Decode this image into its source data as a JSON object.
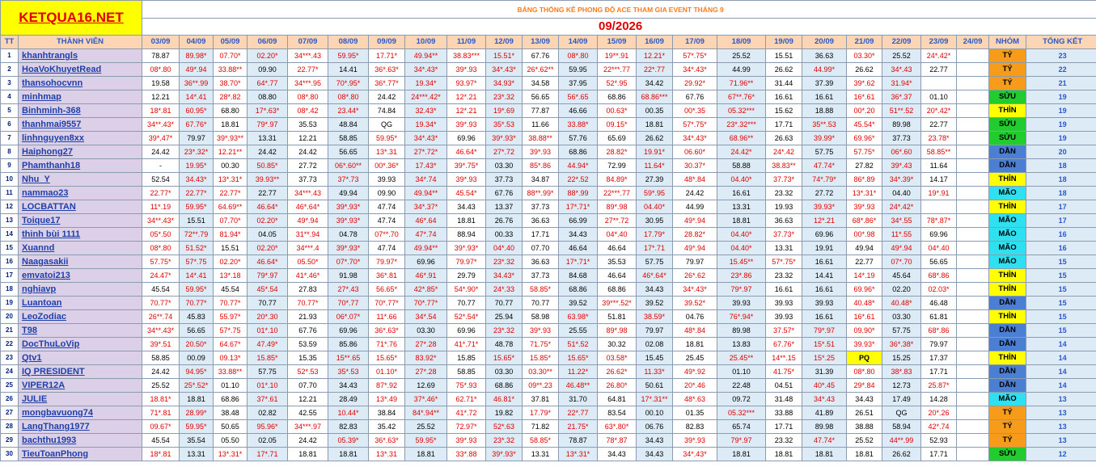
{
  "site_name": "KETQUA16.NET",
  "banner": "BẢNG THỐNG KÊ PHONG ĐỘ ACE THAM GIA EVENT THÁNG 9",
  "month_label": "09/2026",
  "headers": {
    "tt": "TT",
    "member": "THÀNH VIÊN",
    "dates": [
      "03/09",
      "04/09",
      "05/09",
      "06/09",
      "07/09",
      "08/09",
      "09/09",
      "10/09",
      "11/09",
      "12/09",
      "13/09",
      "14/09",
      "15/09",
      "16/09",
      "17/09",
      "18/09",
      "19/09",
      "20/09",
      "21/09",
      "22/09",
      "23/09",
      "24/09"
    ],
    "group": "NHÓM",
    "total": "TỔNG KẾT"
  },
  "group_colors": {
    "TÝ": "#f79b1a",
    "SỬU": "#22cc2f",
    "THÌN": "#ffff00",
    "DẦN": "#4a7fd4",
    "MÃO": "#2fe0f0"
  },
  "rows": [
    {
      "tt": "1",
      "name": "khanhtrangls",
      "vals": [
        "78.87",
        "89.98*",
        "07.70*",
        "02.20*",
        "34***.43",
        "59.95*",
        "17.71*",
        "49.94**",
        "38.83***",
        "15.51*",
        "67.76",
        "08*.80",
        "19**.91",
        "12.21*",
        "57*.75*",
        "25.52",
        "15.51",
        "36.63",
        "03.30*",
        "25.52",
        "24*.42*",
        ""
      ],
      "group": "TÝ",
      "total": "23"
    },
    {
      "tt": "2",
      "name": "HoaVoKhuyetRead",
      "vals": [
        "08*.80",
        "49*.94",
        "33.88**",
        "09.90",
        "22.77*",
        "14.41",
        "36*.63*",
        "34*.43*",
        "39*.93",
        "34*.43*",
        "26*.62**",
        "59.95",
        "22***.77",
        "22*.77",
        "34*.43*",
        "44.99",
        "26.62",
        "44.99*",
        "26.62",
        "34*.43",
        "22.77",
        ""
      ],
      "group": "TÝ",
      "total": "22"
    },
    {
      "tt": "3",
      "name": "thansohocvnn",
      "vals": [
        "19.58",
        "36**.99",
        "38.70*",
        "64*.77",
        "34***.95",
        "70*.95*",
        "36*.77*",
        "19.34*",
        "93.97*",
        "34.93*",
        "34.58",
        "37.95",
        "52*.95",
        "34.42",
        "29.92*",
        "71.96**",
        "31.44",
        "37.39",
        "39*.62",
        "31.94*",
        "",
        ""
      ],
      "group": "TÝ",
      "total": "21"
    },
    {
      "tt": "4",
      "name": "minhmap",
      "vals": [
        "12.21",
        "14*.41",
        "28*.82",
        "08.80",
        "08*.80",
        "08*.80",
        "24.42",
        "24***.42*",
        "12*.21",
        "23*.32",
        "56.65",
        "56*.65",
        "68.86",
        "68.86***",
        "67.76",
        "67**.76*",
        "16.61",
        "16.61",
        "16*.61",
        "36*.37",
        "01.10",
        ""
      ],
      "group": "SỬU",
      "total": "19"
    },
    {
      "tt": "5",
      "name": "Binhminh-368",
      "vals": [
        "18*.81",
        "60.95*",
        "68.80",
        "17*.63*",
        "08*.42",
        "23.44*",
        "74.84",
        "32.43*",
        "12*.21",
        "19*.69",
        "77.87",
        "46.66",
        "00.63*",
        "00.35",
        "00*.35",
        "05.32***",
        "15.62",
        "18.88",
        "00*.20",
        "51**.52",
        "20*.42*",
        ""
      ],
      "group": "THÌN",
      "total": "19"
    },
    {
      "tt": "6",
      "name": "thanhmai9557",
      "vals": [
        "34**.43*",
        "67.76*",
        "18.81",
        "79*.97",
        "35.53",
        "48.84",
        "QG",
        "19.34*",
        "39*.93",
        "35*.53",
        "11.66",
        "33.88*",
        "09.15*",
        "18.81",
        "57*.75*",
        "23*.32***",
        "17.71",
        "35**.53",
        "45.54*",
        "89.98",
        "22.77",
        ""
      ],
      "group": "SỬU",
      "total": "19"
    },
    {
      "tt": "7",
      "name": "linhnguyen8xx",
      "vals": [
        "39*.47*",
        "79.97",
        "39*.93**",
        "13.31",
        "12.21",
        "58.85",
        "59.95*",
        "34*.43*",
        "69.96",
        "39*.93*",
        "38.88**",
        "57.76",
        "65.69",
        "26.62",
        "34*.43*",
        "68.96**",
        "26.63",
        "39.99*",
        "69.96*",
        "37.73",
        "23.78*",
        ""
      ],
      "group": "SỬU",
      "total": "19"
    },
    {
      "tt": "8",
      "name": "Haiphong27",
      "vals": [
        "24.42",
        "23*.32*",
        "12.21**",
        "24.42",
        "24.42",
        "56.65",
        "13*.31",
        "27*.72*",
        "46.64*",
        "27*.72",
        "39*.93",
        "68.86",
        "28.82*",
        "19.91*",
        "06.60*",
        "24.42*",
        "24*.42",
        "57.75",
        "57.75*",
        "06*.60",
        "58.85**",
        ""
      ],
      "group": "DẦN",
      "total": "20"
    },
    {
      "tt": "9",
      "name": "Phamthanh18",
      "vals": [
        "-",
        "19.95*",
        "00.30",
        "50.85*",
        "27.72",
        "06*.60**",
        "00*.36*",
        "17.43*",
        "39*.75*",
        "03.30",
        "85*.86",
        "44.94*",
        "72.99",
        "11.64*",
        "30.37*",
        "58.88",
        "38.83**",
        "47.74*",
        "27.82",
        "39*.43",
        "11.64",
        ""
      ],
      "group": "DẦN",
      "total": "18"
    },
    {
      "tt": "10",
      "name": "Nhu_Y",
      "vals": [
        "52.54",
        "34.43*",
        "13*.31*",
        "39.93**",
        "37.73",
        "37*.73",
        "39.93",
        "34*.74",
        "39*.93",
        "37.73",
        "34.87",
        "22*.52",
        "84.89*",
        "27.39",
        "48*.84",
        "04.40*",
        "37.73*",
        "74*.79*",
        "86*.89",
        "34*.39*",
        "14.17",
        ""
      ],
      "group": "THÌN",
      "total": "18"
    },
    {
      "tt": "11",
      "name": "nammao23",
      "vals": [
        "22.77*",
        "22.77*",
        "22.77*",
        "22.77",
        "34***.43",
        "49.94",
        "09.90",
        "49.94**",
        "45.54*",
        "67.76",
        "88**.99*",
        "88*.99",
        "22***.77",
        "59*.95",
        "24.42",
        "16.61",
        "23.32",
        "27.72",
        "13*.31*",
        "04.40",
        "19*.91",
        ""
      ],
      "group": "MÃO",
      "total": "18"
    },
    {
      "tt": "12",
      "name": "LOCBATTAN",
      "vals": [
        "11*.19",
        "59.95*",
        "64.69**",
        "46.64*",
        "46*.64*",
        "39*.93*",
        "47.74",
        "34*.37*",
        "34.43",
        "13.37",
        "37.73",
        "17*.71*",
        "89*.98",
        "04.40*",
        "44.99",
        "13.31",
        "19.93",
        "39.93*",
        "39*.93",
        "24*.42*",
        "",
        ""
      ],
      "group": "THÌN",
      "total": "17"
    },
    {
      "tt": "13",
      "name": "Toique17",
      "vals": [
        "34**.43*",
        "15.51",
        "07.70*",
        "02.20*",
        "49*.94",
        "39*.93*",
        "47.74",
        "46*.64",
        "18.81",
        "26.76",
        "36.63",
        "66.99",
        "27**.72",
        "30.95",
        "49*.94",
        "18.81",
        "36.63",
        "12*.21",
        "68*.86*",
        "34*.55",
        "78*.87*",
        ""
      ],
      "group": "MÃO",
      "total": "17"
    },
    {
      "tt": "14",
      "name": "thinh bùi 1111",
      "vals": [
        "05*.50",
        "72**.79",
        "81.94*",
        "04.05",
        "31**.94",
        "04.78",
        "07**.70",
        "47*.74",
        "88.94",
        "00.33",
        "17.71",
        "34.43",
        "04*.40",
        "17.79*",
        "28.82*",
        "04.40*",
        "37.73*",
        "69.96",
        "00*.98",
        "11*.55",
        "69.96",
        ""
      ],
      "group": "MÃO",
      "total": "16"
    },
    {
      "tt": "15",
      "name": "Xuannd",
      "vals": [
        "08*.80",
        "51.52*",
        "15.51",
        "02.20*",
        "34***.4",
        "39*.93*",
        "47.74",
        "49.94**",
        "39*.93*",
        "04*.40",
        "07.70",
        "46.64",
        "46.64",
        "17*.71",
        "49*.94",
        "04.40*",
        "13.31",
        "19.91",
        "49.94",
        "49*.94",
        "04*.40",
        ""
      ],
      "group": "MÃO",
      "total": "16"
    },
    {
      "tt": "16",
      "name": "Naagasakii",
      "vals": [
        "57.75*",
        "57*.75",
        "02.20*",
        "46.64*",
        "05.50*",
        "07*.70*",
        "79.97*",
        "69.96",
        "79.97*",
        "23*.32",
        "36.63",
        "17*.71*",
        "35.53",
        "57.75",
        "79.97",
        "15.45**",
        "57*.75*",
        "16.61",
        "22.77",
        "07*.70",
        "56.65",
        ""
      ],
      "group": "MÃO",
      "total": "15"
    },
    {
      "tt": "17",
      "name": "emvatoi213",
      "vals": [
        "24.47*",
        "14*.41",
        "13*.18",
        "79*.97",
        "41*.46*",
        "91.98",
        "36*.81",
        "46*.91",
        "29.79",
        "34.43*",
        "37.73",
        "84.68",
        "46.64",
        "46*.64*",
        "26*.62",
        "23*.86",
        "23.32",
        "14.41",
        "14*.19",
        "45.64",
        "68*.86",
        ""
      ],
      "group": "THÌN",
      "total": "15"
    },
    {
      "tt": "18",
      "name": "nghiavp",
      "vals": [
        "45.54",
        "59.95*",
        "45.54",
        "45*.54",
        "27.83",
        "27*.43",
        "56.65*",
        "42*.85*",
        "54*.90*",
        "24*.33",
        "58.85*",
        "68.86",
        "68.86",
        "34.43",
        "34*.43*",
        "79*.97",
        "16.61",
        "16.61",
        "69.96*",
        "02.20",
        "02.03*",
        ""
      ],
      "group": "THÌN",
      "total": "15"
    },
    {
      "tt": "19",
      "name": "Luantoan",
      "vals": [
        "70.77*",
        "70.77*",
        "70.77*",
        "70.77",
        "70.77*",
        "70*.77",
        "70*.77*",
        "70*.77*",
        "70.77",
        "70.77",
        "70.77",
        "39.52",
        "39***.52*",
        "39.52",
        "39.52*",
        "39.93",
        "39.93",
        "39.93",
        "40.48*",
        "40.48*",
        "46.48",
        ""
      ],
      "group": "DẦN",
      "total": "15"
    },
    {
      "tt": "20",
      "name": "LeoZodiac",
      "vals": [
        "26**.74",
        "45.83",
        "55.97*",
        "20*.30",
        "21.93",
        "06*.07*",
        "11*.66",
        "34*.54",
        "52*.54*",
        "25.94",
        "58.98",
        "63.98*",
        "51.81",
        "38.59*",
        "04.76",
        "76*.94*",
        "39.93",
        "16.61",
        "16*.61",
        "03.30",
        "61.81",
        ""
      ],
      "group": "THÌN",
      "total": "15"
    },
    {
      "tt": "21",
      "name": "T98",
      "vals": [
        "34**.43*",
        "56.65",
        "57*.75",
        "01*.10",
        "67.76",
        "69.96",
        "36*.63*",
        "03.30",
        "69.96",
        "23*.32",
        "39*.93",
        "25.55",
        "89*.98",
        "79.97",
        "48*.84",
        "89.98",
        "37.57*",
        "79*.97",
        "09.90*",
        "57.75",
        "68*.86",
        ""
      ],
      "group": "DẦN",
      "total": "15"
    },
    {
      "tt": "22",
      "name": "DocThuLoVip",
      "vals": [
        "39*.51",
        "20.50*",
        "64.67*",
        "47.49*",
        "53.59",
        "85.86",
        "71*.76",
        "27*.28",
        "41*.71*",
        "48.78",
        "71.75*",
        "51*.52",
        "30.32",
        "02.08",
        "18.81",
        "13.83",
        "67.76*",
        "15*.51",
        "39.93*",
        "36*.38*",
        "79.97",
        ""
      ],
      "group": "DẦN",
      "total": "14"
    },
    {
      "tt": "23",
      "name": "Qtv1",
      "vals": [
        "58.85",
        "00.09",
        "09.13*",
        "15.85*",
        "15.35",
        "15**.65",
        "15.65*",
        "83.92*",
        "15.85",
        "15.65*",
        "15.85*",
        "15.65*",
        "03.58*",
        "15.45",
        "25.45",
        "25.45**",
        "14**.15",
        "15*.25",
        "PQ",
        "15.25",
        "17.37",
        ""
      ],
      "group": "THÌN",
      "total": "14"
    },
    {
      "tt": "24",
      "name": "IQ PRESIDENT",
      "vals": [
        "24.42",
        "94.95*",
        "33.88**",
        "57.75",
        "52*.53",
        "35*.53",
        "01.10*",
        "27*.28",
        "58.85",
        "03.30",
        "03.30**",
        "11.22*",
        "26.62*",
        "11.33*",
        "49*.92",
        "01.10",
        "41.75*",
        "31.39",
        "08*.80",
        "38*.83",
        "17.71",
        ""
      ],
      "group": "DẦN",
      "total": "14"
    },
    {
      "tt": "25",
      "name": "VIPER12A",
      "vals": [
        "25.52",
        "25*.52*",
        "01.10",
        "01*.10",
        "07.70",
        "34.43",
        "87*.92",
        "12.69",
        "75*.93",
        "68.86",
        "09**.23",
        "46.48**",
        "26.80*",
        "50.61",
        "20*.46",
        "22.48",
        "04.51",
        "40*.45",
        "29*.84",
        "12.73",
        "25.87*",
        ""
      ],
      "group": "DẦN",
      "total": "14"
    },
    {
      "tt": "26",
      "name": "JULIE",
      "vals": [
        "18.81*",
        "18.81",
        "68.86",
        "37*.61",
        "12.21",
        "28.49",
        "13*.49",
        "37*.46*",
        "62.71*",
        "46.81*",
        "37.81",
        "31.70",
        "64.81",
        "17*.31**",
        "48*.63",
        "09.72",
        "31.48",
        "34*.43",
        "34.43",
        "17.49",
        "14.28",
        ""
      ],
      "group": "MÃO",
      "total": "13"
    },
    {
      "tt": "27",
      "name": "mongbavuong74",
      "vals": [
        "71*.81",
        "28.99*",
        "38.48",
        "02.82",
        "42.55",
        "10.44*",
        "38.84",
        "84*.94**",
        "41*.72",
        "19.82",
        "17.79*",
        "22*.77",
        "83.54",
        "00.10",
        "01.35",
        "05.32***",
        "33.88",
        "41.89",
        "26.51",
        "QG",
        "20*.26",
        ""
      ],
      "group": "TÝ",
      "total": "13"
    },
    {
      "tt": "28",
      "name": "LangThang1977",
      "vals": [
        "09.67*",
        "59.95*",
        "50.65",
        "95.96*",
        "34***.97",
        "82.83",
        "35.42",
        "25.52",
        "72.97*",
        "52*.63",
        "71.82",
        "21.75*",
        "63*.80*",
        "06.76",
        "82.83",
        "65.74",
        "17.71",
        "89.98",
        "38.88",
        "58.94",
        "42*.74",
        ""
      ],
      "group": "TÝ",
      "total": "13"
    },
    {
      "tt": "29",
      "name": "bachthu1993",
      "vals": [
        "45.54",
        "35.54",
        "05.50",
        "02.05",
        "24.42",
        "05.39*",
        "36*.63*",
        "59.95*",
        "39*.93",
        "23*.32",
        "58.85*",
        "78.87",
        "78*.87",
        "34.43",
        "39*.93",
        "79*.97",
        "23.32",
        "47.74*",
        "25.52",
        "44**.99",
        "52.93",
        ""
      ],
      "group": "TÝ",
      "total": "13"
    },
    {
      "tt": "30",
      "name": "TieuToanPhong",
      "vals": [
        "18*.81",
        "13.31",
        "13*.31*",
        "17*.71",
        "18.81",
        "18.81",
        "13*.31",
        "18.81",
        "33*.88",
        "39*.93*",
        "13.31",
        "13*.31*",
        "34.43",
        "34.43",
        "34*.43*",
        "18.81",
        "18.81",
        "18.81",
        "18.81",
        "26.62",
        "17.71",
        ""
      ],
      "group": "SỬU",
      "total": "12"
    }
  ]
}
